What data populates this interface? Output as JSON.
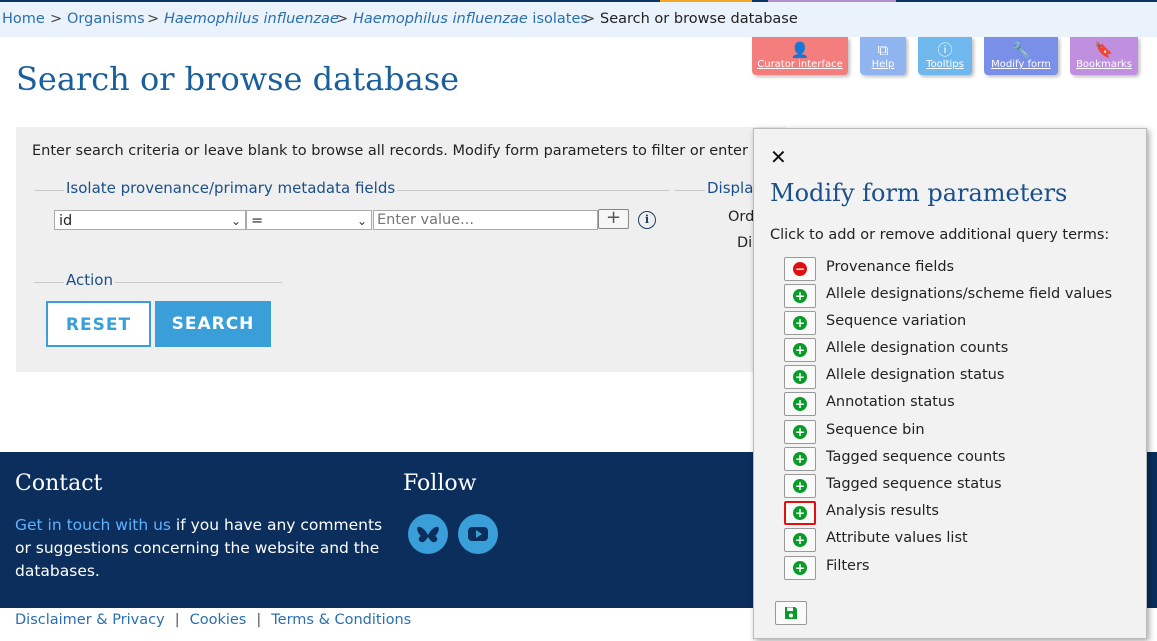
{
  "breadcrumb": {
    "home": "Home",
    "organisms": "Organisms",
    "species": "Haemophilus influenzae",
    "isolates_species": "Haemophilus influenzae",
    "isolates_suffix": " isolates",
    "current": "Search or browse database",
    "separator": ">"
  },
  "toolbar": [
    {
      "label": "Curator interface",
      "icon": "curator-icon",
      "color": "#f47d7d"
    },
    {
      "label": "Help",
      "icon": "external-link-icon",
      "color": "#8fb4f0"
    },
    {
      "label": "Tooltips",
      "icon": "info-icon",
      "color": "#6fb8ee"
    },
    {
      "label": "Modify form",
      "icon": "wrench-icon",
      "color": "#7a8fe8"
    },
    {
      "label": "Bookmarks",
      "icon": "bookmark-icon",
      "color": "#c08fe0"
    }
  ],
  "page_title": "Search or browse database",
  "form": {
    "intro": "Enter search criteria or leave blank to browse all records. Modify form parameters to filter or enter a list of",
    "provenance_legend": "Isolate provenance/primary metadata fields",
    "field_value": "id",
    "operator_value": "=",
    "value_placeholder": "Enter value...",
    "plus_label": "+",
    "info_label": "i",
    "display_legend": "Displa",
    "order_label": "Ord",
    "display_label": "Di",
    "action_legend": "Action",
    "reset_label": "RESET",
    "search_label": "SEARCH"
  },
  "footer": {
    "contact_title": "Contact",
    "contact_link": "Get in touch with us",
    "contact_text": " if you have any comments or suggestions concerning the website and the databases.",
    "follow_title": "Follow",
    "social": [
      "bluesky-icon",
      "youtube-icon"
    ]
  },
  "bottom_links": {
    "disclaimer": "Disclaimer & Privacy",
    "cookies": "Cookies",
    "terms": "Terms & Conditions",
    "pipe": "|"
  },
  "modal": {
    "close": "✕",
    "title": "Modify form parameters",
    "help": "Click to add or remove additional query terms:",
    "options": [
      {
        "label": "Provenance fields",
        "state": "remove"
      },
      {
        "label": "Allele designations/scheme field values",
        "state": "add"
      },
      {
        "label": "Sequence variation",
        "state": "add"
      },
      {
        "label": "Allele designation counts",
        "state": "add"
      },
      {
        "label": "Allele designation status",
        "state": "add"
      },
      {
        "label": "Annotation status",
        "state": "add"
      },
      {
        "label": "Sequence bin",
        "state": "add"
      },
      {
        "label": "Tagged sequence counts",
        "state": "add"
      },
      {
        "label": "Tagged sequence status",
        "state": "add"
      },
      {
        "label": "Analysis results",
        "state": "add",
        "highlighted": true
      },
      {
        "label": "Attribute values list",
        "state": "add"
      },
      {
        "label": "Filters",
        "state": "add"
      }
    ],
    "save_icon": "save-icon"
  },
  "colors": {
    "add": "#0a9b2a",
    "remove": "#e01010",
    "highlight": "#e01010",
    "footer_bg": "#0b2e5c",
    "accent": "#3a9fd8"
  }
}
